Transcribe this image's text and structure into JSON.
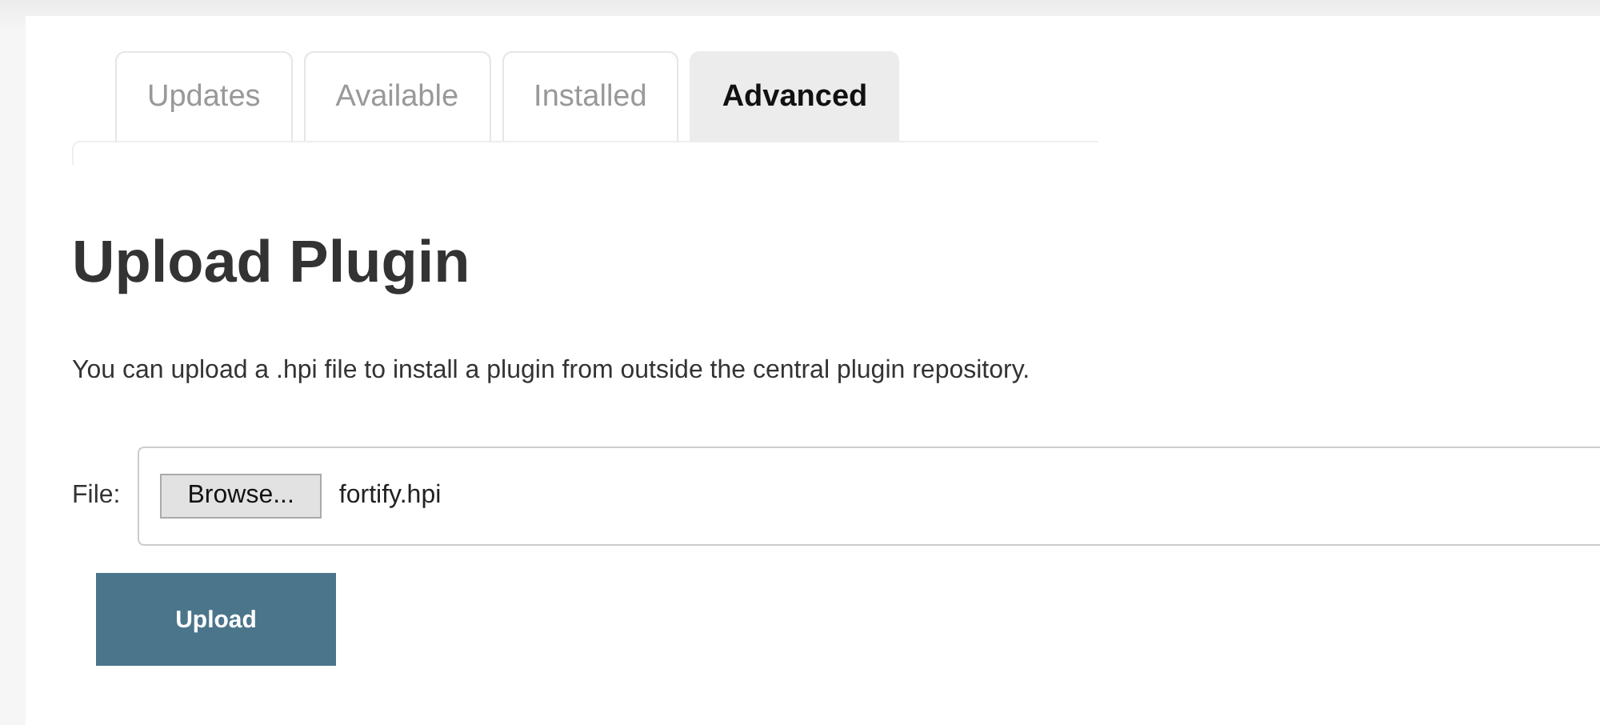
{
  "tabs": [
    {
      "label": "Updates",
      "selected": false
    },
    {
      "label": "Available",
      "selected": false
    },
    {
      "label": "Installed",
      "selected": false
    },
    {
      "label": "Advanced",
      "selected": true
    }
  ],
  "heading": "Upload Plugin",
  "description": "You can upload a .hpi file to install a plugin from outside the central plugin repository.",
  "file": {
    "label": "File:",
    "button": "Browse...",
    "value": "fortify.hpi"
  },
  "submit": "Upload"
}
